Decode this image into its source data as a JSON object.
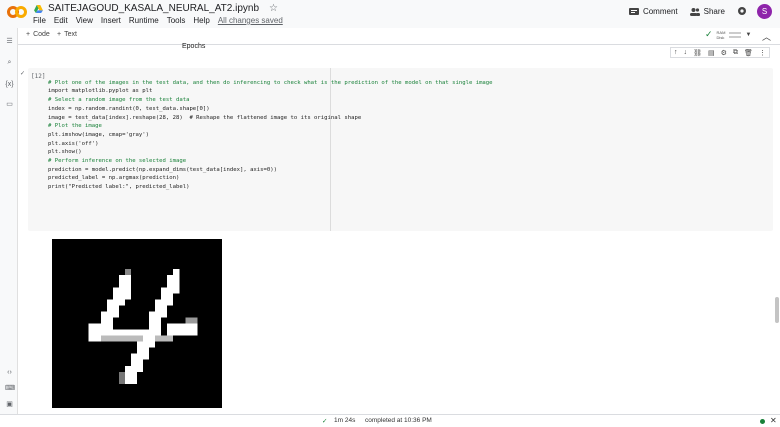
{
  "header": {
    "title": "SAITEJAGOUD_KASALA_NEURAL_AT2.ipynb",
    "menu": [
      "File",
      "Edit",
      "View",
      "Insert",
      "Runtime",
      "Tools",
      "Help"
    ],
    "saved_status": "All changes saved",
    "comment_label": "Comment",
    "share_label": "Share",
    "avatar_letter": "S"
  },
  "toolbar": {
    "add_code_label": "Code",
    "add_text_label": "Text",
    "ram_label": "RAM",
    "disk_label": "Disk"
  },
  "previous_output": {
    "label": "Epochs"
  },
  "cell": {
    "execution_count": "[12]",
    "lines": [
      "# Plot one of the images in the test data, and then do inferencing to check what is the prediction of the model on that single image",
      "",
      "import matplotlib.pyplot as plt",
      "",
      "# Select a random image from the test data",
      "index = np.random.randint(0, test_data.shape[0])",
      "image = test_data[index].reshape(28, 28)  # Reshape the flattened image to its original shape",
      "",
      "# Plot the image",
      "plt.imshow(image, cmap='gray')",
      "plt.axis('off')",
      "plt.show()",
      "",
      "# Perform inference on the selected image",
      "prediction = model.predict(np.expand_dims(test_data[index], axis=0))",
      "predicted_label = np.argmax(prediction)",
      "",
      "print(\"Predicted label:\", predicted_label)"
    ]
  },
  "output_image": {
    "description_icon": "digit-image"
  },
  "status": {
    "duration": "1m 24s",
    "completed": "completed at 10:36 PM"
  },
  "colors": {
    "accent_green": "#188038",
    "avatar": "#8e24aa"
  }
}
